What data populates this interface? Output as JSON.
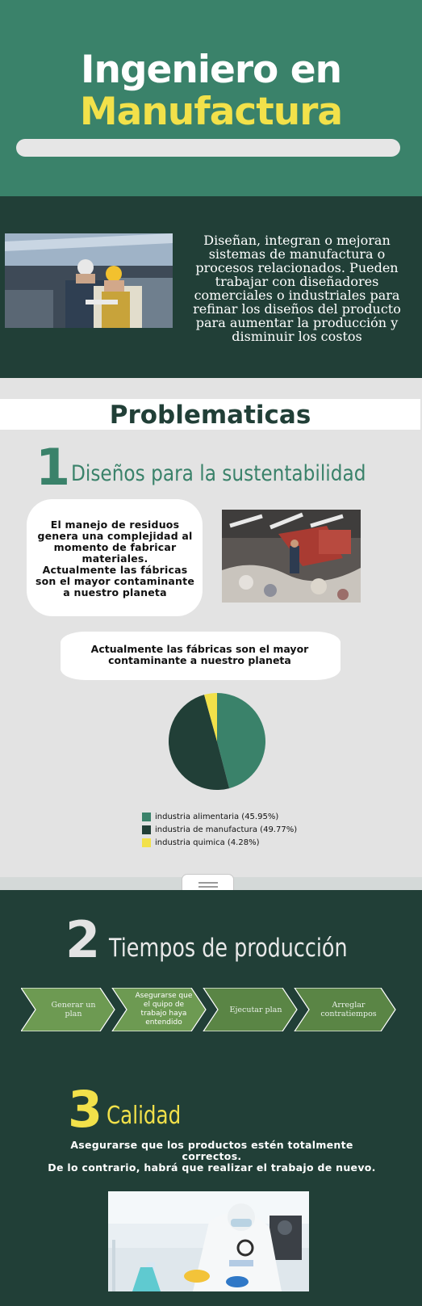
{
  "header": {
    "title_line1": "Ingeniero en",
    "title_line2": "Manufactura"
  },
  "intro": {
    "text": "Diseñan, integran o mejoran sistemas de manufactura o procesos relacionados. Pueden trabajar con diseñadores comerciales o industriales para refinar los diseños del producto para aumentar la producción y disminuir los costos"
  },
  "problems": {
    "title": "Problematicas",
    "section1": {
      "number": "1",
      "title": "Diseños para la sustentabilidad",
      "bubble_text": "El manejo de residuos genera una complejidad al momento de fabricar materiales.\nActualmente las fábricas son el mayor contaminante a nuestro planeta",
      "stat_title": "Actualmente las fábricas son el mayor contaminante a nuestro planeta"
    }
  },
  "chart_data": {
    "type": "pie",
    "title": "",
    "series": [
      {
        "name": "industria alimentaria (45.95%)",
        "value": 45.95,
        "color": "#3a826a"
      },
      {
        "name": "industria de manufactura (49.77%)",
        "value": 49.77,
        "color": "#213f37"
      },
      {
        "name": "industria quimica (4.28%)",
        "value": 4.28,
        "color": "#f2e14a"
      }
    ],
    "legend": "bottom"
  },
  "section2": {
    "number": "2",
    "title": "Tiempos de producción",
    "steps": [
      {
        "label": "Generar un plan"
      },
      {
        "label": "Asegurarse que el quipo de trabajo haya entendido"
      },
      {
        "label": "Ejecutar plan"
      },
      {
        "label": "Arreglar contratiempos"
      }
    ]
  },
  "section3": {
    "number": "3",
    "title": "Calidad",
    "text": "Asegurarse que los productos estén totalmente correctos.\nDe lo contrario, habrá que realizar el trabajo de nuevo."
  },
  "colors": {
    "green": "#3a826a",
    "dark_green": "#213f37",
    "yellow": "#f2e14a",
    "light_gray": "#e3e3e3"
  }
}
